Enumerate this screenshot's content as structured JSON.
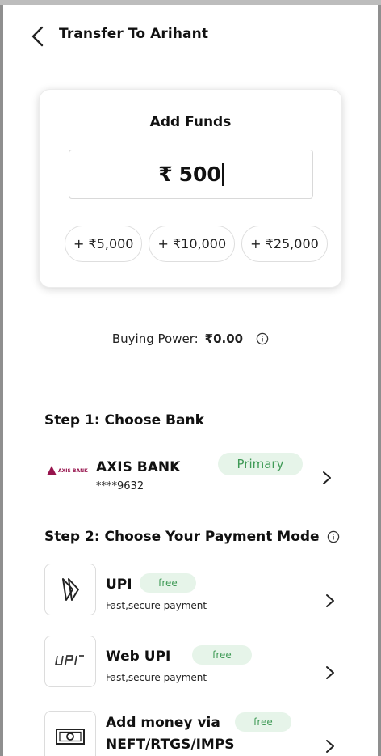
{
  "header": {
    "title": "Transfer To Arihant"
  },
  "add_funds": {
    "title": "Add Funds",
    "currency": "₹",
    "amount": "500",
    "quick_add": [
      "+ ₹5,000",
      "+ ₹10,000",
      "+ ₹25,000"
    ]
  },
  "buying_power": {
    "label": "Buying Power:",
    "value": "₹0.00"
  },
  "step1": {
    "title": "Step 1: Choose Bank",
    "bank": {
      "logo_text": "AXIS BANK",
      "name": "AXIS BANK",
      "account": "****9632",
      "badge": "Primary"
    }
  },
  "step2": {
    "title": "Step 2: Choose Your Payment Mode",
    "modes": [
      {
        "name": "UPI",
        "subtitle": "Fast,secure payment",
        "badge": "free",
        "icon": "upi-arrow-icon"
      },
      {
        "name": "Web UPI",
        "subtitle": "Fast,secure payment",
        "badge": "free",
        "icon": "upi-logo-icon"
      },
      {
        "name": "Add money via",
        "name_line2": "NEFT/RTGS/IMPS",
        "badge": "free",
        "icon": "banknote-icon"
      }
    ]
  },
  "colors": {
    "accent_green": "#3f9a56",
    "badge_bg": "#e6f4e9",
    "axis_brand": "#97144d"
  }
}
